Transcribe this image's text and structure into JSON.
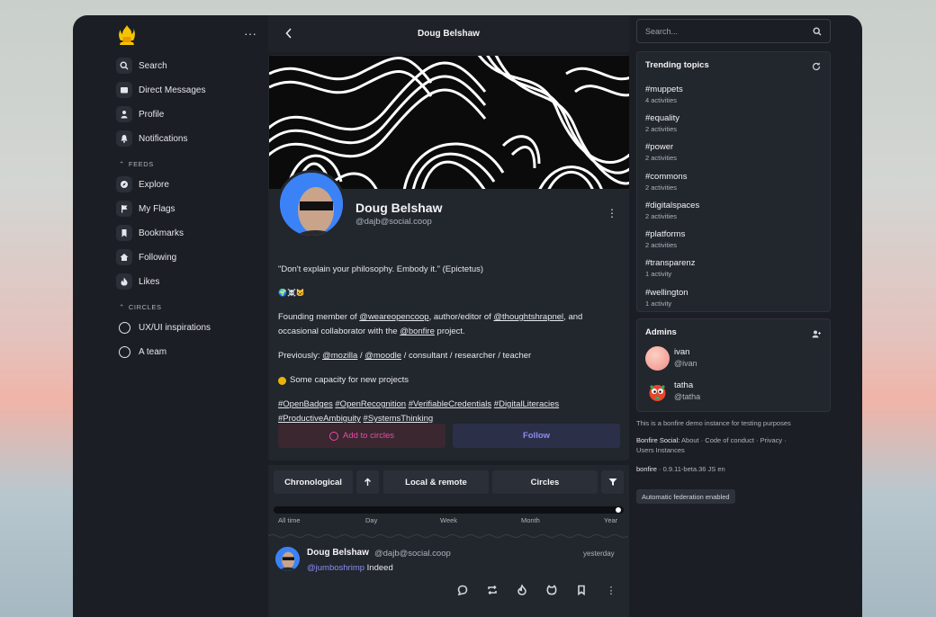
{
  "colors": {
    "window": "#1b1e24",
    "card": "#22262d",
    "accent_pink": "#e84ba8",
    "accent_indigo": "#8b8ef0"
  },
  "sidebar": {
    "more": "···",
    "items": [
      {
        "label": "Search",
        "icon": "search-icon"
      },
      {
        "label": "Direct Messages",
        "icon": "inbox-icon"
      },
      {
        "label": "Profile",
        "icon": "user-icon"
      },
      {
        "label": "Notifications",
        "icon": "bell-icon"
      }
    ],
    "feeds_heading": "FEEDS",
    "feeds": [
      {
        "label": "Explore",
        "icon": "compass-icon"
      },
      {
        "label": "My Flags",
        "icon": "flag-icon"
      },
      {
        "label": "Bookmarks",
        "icon": "bookmark-icon"
      },
      {
        "label": "Following",
        "icon": "home-icon"
      },
      {
        "label": "Likes",
        "icon": "flame-icon"
      }
    ],
    "circles_heading": "CIRCLES",
    "circles": [
      {
        "label": "UX/UI inspirations"
      },
      {
        "label": "A team"
      }
    ]
  },
  "header": {
    "title": "Doug Belshaw"
  },
  "profile": {
    "name": "Doug Belshaw",
    "handle": "@dajb@social.coop",
    "quote": "\"Don't explain your philosophy. Embody it.\" (Epictetus)",
    "emojis": "🌍☠️🐱",
    "founding_prefix": "Founding member of ",
    "link_weareopencoop": "@weareopencoop",
    "founding_mid": ", author/editor of ",
    "link_thoughtshrapnel": "@thoughtshrapnel",
    "founding_suffix": ", and",
    "line2_prefix": "occasional collaborator with the ",
    "link_bonfire": "@bonfire",
    "line2_suffix": " project.",
    "previously_prefix": "Previously: ",
    "link_mozilla": "@mozilla",
    "sep": " / ",
    "link_moodle": "@moodle",
    "previously_suffix": " / consultant / researcher / teacher",
    "capacity": "Some capacity for new projects",
    "hashtags_line1": [
      "#OpenBadges",
      "#OpenRecognition",
      "#VerifiableCredentials",
      "#DigitalLiteracies"
    ],
    "hashtags_line2": [
      "#ProductiveAmbiguity",
      "#SystemsThinking"
    ],
    "add_to_circles": "Add to circles",
    "follow": "Follow"
  },
  "feed": {
    "tabs": [
      "Chronological",
      "Local & remote",
      "Circles"
    ],
    "slider_ticks": [
      "All time",
      "Day",
      "Week",
      "Month",
      "Year"
    ],
    "slider_value": "Year",
    "post": {
      "author": "Doug Belshaw",
      "handle": "@dajb@social.coop",
      "time": "yesterday",
      "mention": "@jumboshrimp",
      "text": " Indeed"
    }
  },
  "right": {
    "search_placeholder": "Search...",
    "trending_title": "Trending topics",
    "trending": [
      {
        "tag": "#muppets",
        "count": "4 activities"
      },
      {
        "tag": "#equality",
        "count": "2 activities"
      },
      {
        "tag": "#power",
        "count": "2 activities"
      },
      {
        "tag": "#commons",
        "count": "2 activities"
      },
      {
        "tag": "#digitalspaces",
        "count": "2 activities"
      },
      {
        "tag": "#platforms",
        "count": "2 activities"
      },
      {
        "tag": "#transparenz",
        "count": "1 activity"
      },
      {
        "tag": "#wellington",
        "count": "1 activity"
      }
    ],
    "admins_title": "Admins",
    "admins": [
      {
        "name": "ivan",
        "handle": "@ivan"
      },
      {
        "name": "tatha",
        "handle": "@tatha"
      }
    ],
    "demo_note": "This is a bonfire demo instance for testing purposes",
    "footer_brand": "Bonfire Social:",
    "footer_links": " About · Code of conduct · Privacy ·",
    "footer_links2": "Users Instances",
    "version_brand": "bonfire",
    "version": " · 0.9.11-beta.36  JS  en",
    "federation": "Automatic federation enabled"
  }
}
